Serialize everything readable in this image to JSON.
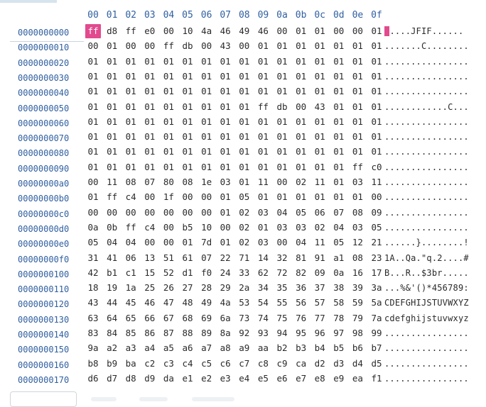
{
  "header": {
    "columns": [
      "00",
      "01",
      "02",
      "03",
      "04",
      "05",
      "06",
      "07",
      "08",
      "09",
      "0a",
      "0b",
      "0c",
      "0d",
      "0e",
      "0f"
    ]
  },
  "selection": {
    "row": 0,
    "col": 0
  },
  "rows": [
    {
      "offset": "0000000000",
      "bytes": [
        "ff",
        "d8",
        "ff",
        "e0",
        "00",
        "10",
        "4a",
        "46",
        "49",
        "46",
        "00",
        "01",
        "01",
        "00",
        "00",
        "01"
      ],
      "ascii": ".....JFIF......"
    },
    {
      "offset": "0000000010",
      "bytes": [
        "00",
        "01",
        "00",
        "00",
        "ff",
        "db",
        "00",
        "43",
        "00",
        "01",
        "01",
        "01",
        "01",
        "01",
        "01",
        "01"
      ],
      "ascii": ".......C........"
    },
    {
      "offset": "0000000020",
      "bytes": [
        "01",
        "01",
        "01",
        "01",
        "01",
        "01",
        "01",
        "01",
        "01",
        "01",
        "01",
        "01",
        "01",
        "01",
        "01",
        "01"
      ],
      "ascii": "................"
    },
    {
      "offset": "0000000030",
      "bytes": [
        "01",
        "01",
        "01",
        "01",
        "01",
        "01",
        "01",
        "01",
        "01",
        "01",
        "01",
        "01",
        "01",
        "01",
        "01",
        "01"
      ],
      "ascii": "................"
    },
    {
      "offset": "0000000040",
      "bytes": [
        "01",
        "01",
        "01",
        "01",
        "01",
        "01",
        "01",
        "01",
        "01",
        "01",
        "01",
        "01",
        "01",
        "01",
        "01",
        "01"
      ],
      "ascii": "................"
    },
    {
      "offset": "0000000050",
      "bytes": [
        "01",
        "01",
        "01",
        "01",
        "01",
        "01",
        "01",
        "01",
        "01",
        "ff",
        "db",
        "00",
        "43",
        "01",
        "01",
        "01"
      ],
      "ascii": "............C..."
    },
    {
      "offset": "0000000060",
      "bytes": [
        "01",
        "01",
        "01",
        "01",
        "01",
        "01",
        "01",
        "01",
        "01",
        "01",
        "01",
        "01",
        "01",
        "01",
        "01",
        "01"
      ],
      "ascii": "................"
    },
    {
      "offset": "0000000070",
      "bytes": [
        "01",
        "01",
        "01",
        "01",
        "01",
        "01",
        "01",
        "01",
        "01",
        "01",
        "01",
        "01",
        "01",
        "01",
        "01",
        "01"
      ],
      "ascii": "................"
    },
    {
      "offset": "0000000080",
      "bytes": [
        "01",
        "01",
        "01",
        "01",
        "01",
        "01",
        "01",
        "01",
        "01",
        "01",
        "01",
        "01",
        "01",
        "01",
        "01",
        "01"
      ],
      "ascii": "................"
    },
    {
      "offset": "0000000090",
      "bytes": [
        "01",
        "01",
        "01",
        "01",
        "01",
        "01",
        "01",
        "01",
        "01",
        "01",
        "01",
        "01",
        "01",
        "01",
        "ff",
        "c0"
      ],
      "ascii": "................"
    },
    {
      "offset": "00000000a0",
      "bytes": [
        "00",
        "11",
        "08",
        "07",
        "80",
        "08",
        "1e",
        "03",
        "01",
        "11",
        "00",
        "02",
        "11",
        "01",
        "03",
        "11"
      ],
      "ascii": "................"
    },
    {
      "offset": "00000000b0",
      "bytes": [
        "01",
        "ff",
        "c4",
        "00",
        "1f",
        "00",
        "00",
        "01",
        "05",
        "01",
        "01",
        "01",
        "01",
        "01",
        "01",
        "00"
      ],
      "ascii": "................"
    },
    {
      "offset": "00000000c0",
      "bytes": [
        "00",
        "00",
        "00",
        "00",
        "00",
        "00",
        "00",
        "01",
        "02",
        "03",
        "04",
        "05",
        "06",
        "07",
        "08",
        "09"
      ],
      "ascii": "................"
    },
    {
      "offset": "00000000d0",
      "bytes": [
        "0a",
        "0b",
        "ff",
        "c4",
        "00",
        "b5",
        "10",
        "00",
        "02",
        "01",
        "03",
        "03",
        "02",
        "04",
        "03",
        "05"
      ],
      "ascii": "................"
    },
    {
      "offset": "00000000e0",
      "bytes": [
        "05",
        "04",
        "04",
        "00",
        "00",
        "01",
        "7d",
        "01",
        "02",
        "03",
        "00",
        "04",
        "11",
        "05",
        "12",
        "21"
      ],
      "ascii": "......}........!"
    },
    {
      "offset": "00000000f0",
      "bytes": [
        "31",
        "41",
        "06",
        "13",
        "51",
        "61",
        "07",
        "22",
        "71",
        "14",
        "32",
        "81",
        "91",
        "a1",
        "08",
        "23"
      ],
      "ascii": "1A..Qa.\"q.2....#"
    },
    {
      "offset": "0000000100",
      "bytes": [
        "42",
        "b1",
        "c1",
        "15",
        "52",
        "d1",
        "f0",
        "24",
        "33",
        "62",
        "72",
        "82",
        "09",
        "0a",
        "16",
        "17"
      ],
      "ascii": "B...R..$3br....."
    },
    {
      "offset": "0000000110",
      "bytes": [
        "18",
        "19",
        "1a",
        "25",
        "26",
        "27",
        "28",
        "29",
        "2a",
        "34",
        "35",
        "36",
        "37",
        "38",
        "39",
        "3a"
      ],
      "ascii": "...%&'()*456789:"
    },
    {
      "offset": "0000000120",
      "bytes": [
        "43",
        "44",
        "45",
        "46",
        "47",
        "48",
        "49",
        "4a",
        "53",
        "54",
        "55",
        "56",
        "57",
        "58",
        "59",
        "5a"
      ],
      "ascii": "CDEFGHIJSTUVWXYZ"
    },
    {
      "offset": "0000000130",
      "bytes": [
        "63",
        "64",
        "65",
        "66",
        "67",
        "68",
        "69",
        "6a",
        "73",
        "74",
        "75",
        "76",
        "77",
        "78",
        "79",
        "7a"
      ],
      "ascii": "cdefghijstuvwxyz"
    },
    {
      "offset": "0000000140",
      "bytes": [
        "83",
        "84",
        "85",
        "86",
        "87",
        "88",
        "89",
        "8a",
        "92",
        "93",
        "94",
        "95",
        "96",
        "97",
        "98",
        "99"
      ],
      "ascii": "................"
    },
    {
      "offset": "0000000150",
      "bytes": [
        "9a",
        "a2",
        "a3",
        "a4",
        "a5",
        "a6",
        "a7",
        "a8",
        "a9",
        "aa",
        "b2",
        "b3",
        "b4",
        "b5",
        "b6",
        "b7"
      ],
      "ascii": "................"
    },
    {
      "offset": "0000000160",
      "bytes": [
        "b8",
        "b9",
        "ba",
        "c2",
        "c3",
        "c4",
        "c5",
        "c6",
        "c7",
        "c8",
        "c9",
        "ca",
        "d2",
        "d3",
        "d4",
        "d5"
      ],
      "ascii": "................"
    },
    {
      "offset": "0000000170",
      "bytes": [
        "d6",
        "d7",
        "d8",
        "d9",
        "da",
        "e1",
        "e2",
        "e3",
        "e4",
        "e5",
        "e6",
        "e7",
        "e8",
        "e9",
        "ea",
        "f1"
      ],
      "ascii": "................"
    }
  ],
  "colors": {
    "selection": "#e24a8e",
    "offset_text": "#2f5fa0",
    "byte_text": "#2a2a2a"
  }
}
